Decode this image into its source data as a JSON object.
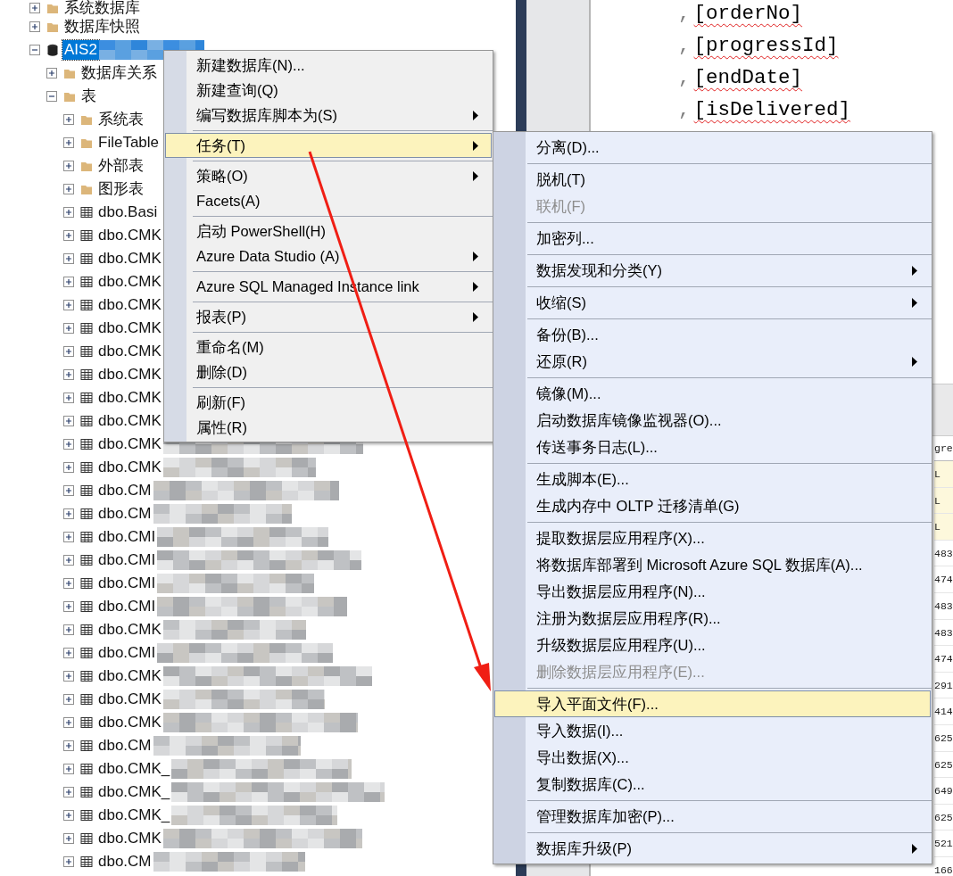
{
  "tree": [
    {
      "label": "系统数据库",
      "kind": "folder",
      "expanded": false,
      "selected": false
    },
    {
      "label": "数据库快照",
      "kind": "folder",
      "expanded": false,
      "selected": false
    },
    {
      "label": "AIS2",
      "kind": "database",
      "expanded": true,
      "selected": true,
      "redacted": true,
      "children": [
        {
          "label": "数据库关系",
          "kind": "folder",
          "expanded": false,
          "selected": false
        },
        {
          "label": "表",
          "kind": "folder",
          "expanded": true,
          "selected": false,
          "children": [
            {
              "label": "系统表",
              "kind": "folder",
              "expanded": false,
              "selected": false
            },
            {
              "label": "FileTable",
              "kind": "folder",
              "expanded": false,
              "selected": false
            },
            {
              "label": "外部表",
              "kind": "folder",
              "expanded": false,
              "selected": false
            },
            {
              "label": "图形表",
              "kind": "folder",
              "expanded": false,
              "selected": false
            },
            {
              "label": "dbo.Basi",
              "kind": "table",
              "expanded": false,
              "selected": false
            },
            {
              "label": "dbo.CMK",
              "kind": "table",
              "expanded": false,
              "selected": false
            },
            {
              "label": "dbo.CMK",
              "kind": "table",
              "expanded": false,
              "selected": false
            },
            {
              "label": "dbo.CMK",
              "kind": "table",
              "expanded": false,
              "selected": false
            },
            {
              "label": "dbo.CMK",
              "kind": "table",
              "expanded": false,
              "selected": false
            },
            {
              "label": "dbo.CMK",
              "kind": "table",
              "expanded": false,
              "selected": false
            },
            {
              "label": "dbo.CMK",
              "kind": "table",
              "expanded": false,
              "selected": false
            },
            {
              "label": "dbo.CMK",
              "kind": "table",
              "expanded": false,
              "selected": false
            },
            {
              "label": "dbo.CMK",
              "kind": "table",
              "expanded": false,
              "selected": false
            },
            {
              "label": "dbo.CMK",
              "kind": "table",
              "expanded": false,
              "selected": false
            },
            {
              "label": "dbo.CMK",
              "kind": "table",
              "expanded": false,
              "selected": false,
              "redacted": true
            },
            {
              "label": "dbo.CMK",
              "kind": "table",
              "expanded": false,
              "selected": false,
              "redacted": true
            },
            {
              "label": "dbo.CM",
              "kind": "table",
              "expanded": false,
              "selected": false,
              "redacted": true
            },
            {
              "label": "dbo.CM",
              "kind": "table",
              "expanded": false,
              "selected": false,
              "redacted": true
            },
            {
              "label": "dbo.CMI",
              "kind": "table",
              "expanded": false,
              "selected": false,
              "redacted": true
            },
            {
              "label": "dbo.CMI",
              "kind": "table",
              "expanded": false,
              "selected": false,
              "redacted": true
            },
            {
              "label": "dbo.CMI",
              "kind": "table",
              "expanded": false,
              "selected": false,
              "redacted": true
            },
            {
              "label": "dbo.CMI",
              "kind": "table",
              "expanded": false,
              "selected": false,
              "redacted": true
            },
            {
              "label": "dbo.CMK",
              "kind": "table",
              "expanded": false,
              "selected": false,
              "redacted": true
            },
            {
              "label": "dbo.CMI",
              "kind": "table",
              "expanded": false,
              "selected": false,
              "redacted": true
            },
            {
              "label": "dbo.CMK",
              "kind": "table",
              "expanded": false,
              "selected": false,
              "redacted": true
            },
            {
              "label": "dbo.CMK",
              "kind": "table",
              "expanded": false,
              "selected": false,
              "redacted": true
            },
            {
              "label": "dbo.CMK",
              "kind": "table",
              "expanded": false,
              "selected": false,
              "redacted": true
            },
            {
              "label": "dbo.CM",
              "kind": "table",
              "expanded": false,
              "selected": false,
              "redacted": true
            },
            {
              "label": "dbo.CMK_",
              "kind": "table",
              "expanded": false,
              "selected": false,
              "redacted": true
            },
            {
              "label": "dbo.CMK_",
              "kind": "table",
              "expanded": false,
              "selected": false,
              "redacted": true
            },
            {
              "label": "dbo.CMK_",
              "kind": "table",
              "expanded": false,
              "selected": false,
              "redacted": true
            },
            {
              "label": "dbo.CMK",
              "kind": "table",
              "expanded": false,
              "selected": false,
              "redacted": true
            },
            {
              "label": "dbo.CM",
              "kind": "table",
              "expanded": false,
              "selected": false,
              "redacted": true
            }
          ]
        }
      ]
    }
  ],
  "editor": {
    "lines": [
      {
        "prefix": ",",
        "identifier": "[orderNo]"
      },
      {
        "prefix": ",",
        "identifier": "[progressId]"
      },
      {
        "prefix": ",",
        "identifier": "[endDate]"
      },
      {
        "prefix": ",",
        "identifier": "[isDelivered]"
      }
    ]
  },
  "results": {
    "header": "gre",
    "rows": [
      {
        "value": "L",
        "is_null": true
      },
      {
        "value": "L",
        "is_null": true
      },
      {
        "value": "L",
        "is_null": true
      },
      {
        "value": "483",
        "is_null": false
      },
      {
        "value": "474",
        "is_null": false
      },
      {
        "value": "483",
        "is_null": false
      },
      {
        "value": "483",
        "is_null": false
      },
      {
        "value": "474",
        "is_null": false
      },
      {
        "value": "291",
        "is_null": false
      },
      {
        "value": "414",
        "is_null": false
      },
      {
        "value": "625",
        "is_null": false
      },
      {
        "value": "625",
        "is_null": false
      },
      {
        "value": "649",
        "is_null": false
      },
      {
        "value": "625",
        "is_null": false
      },
      {
        "value": "521",
        "is_null": false
      },
      {
        "value": "166",
        "is_null": false
      }
    ]
  },
  "context_menu": {
    "groups": [
      [
        {
          "label": "新建数据库(N)...",
          "has_submenu": false,
          "selected": false
        },
        {
          "label": "新建查询(Q)",
          "has_submenu": false,
          "selected": false
        },
        {
          "label": "编写数据库脚本为(S)",
          "has_submenu": true,
          "selected": false
        }
      ],
      [
        {
          "label": "任务(T)",
          "has_submenu": true,
          "selected": true
        }
      ],
      [
        {
          "label": "策略(O)",
          "has_submenu": true,
          "selected": false
        },
        {
          "label": "Facets(A)",
          "has_submenu": false,
          "selected": false
        }
      ],
      [
        {
          "label": "启动 PowerShell(H)",
          "has_submenu": false,
          "selected": false
        },
        {
          "label": "Azure Data Studio (A)",
          "has_submenu": true,
          "selected": false
        }
      ],
      [
        {
          "label": "Azure SQL Managed Instance link",
          "has_submenu": true,
          "selected": false
        }
      ],
      [
        {
          "label": "报表(P)",
          "has_submenu": true,
          "selected": false
        }
      ],
      [
        {
          "label": "重命名(M)",
          "has_submenu": false,
          "selected": false
        },
        {
          "label": "删除(D)",
          "has_submenu": false,
          "selected": false
        }
      ],
      [
        {
          "label": "刷新(F)",
          "has_submenu": false,
          "selected": false
        },
        {
          "label": "属性(R)",
          "has_submenu": false,
          "selected": false
        }
      ]
    ]
  },
  "submenu": {
    "groups": [
      [
        {
          "label": "分离(D)...",
          "has_submenu": false,
          "selected": false,
          "disabled": false
        }
      ],
      [
        {
          "label": "脱机(T)",
          "has_submenu": false,
          "selected": false,
          "disabled": false
        },
        {
          "label": "联机(F)",
          "has_submenu": false,
          "selected": false,
          "disabled": true
        }
      ],
      [
        {
          "label": "加密列...",
          "has_submenu": false,
          "selected": false,
          "disabled": false
        }
      ],
      [
        {
          "label": "数据发现和分类(Y)",
          "has_submenu": true,
          "selected": false,
          "disabled": false
        }
      ],
      [
        {
          "label": "收缩(S)",
          "has_submenu": true,
          "selected": false,
          "disabled": false
        }
      ],
      [
        {
          "label": "备份(B)...",
          "has_submenu": false,
          "selected": false,
          "disabled": false
        },
        {
          "label": "还原(R)",
          "has_submenu": true,
          "selected": false,
          "disabled": false
        }
      ],
      [
        {
          "label": "镜像(M)...",
          "has_submenu": false,
          "selected": false,
          "disabled": false
        },
        {
          "label": "启动数据库镜像监视器(O)...",
          "has_submenu": false,
          "selected": false,
          "disabled": false
        },
        {
          "label": "传送事务日志(L)...",
          "has_submenu": false,
          "selected": false,
          "disabled": false
        }
      ],
      [
        {
          "label": "生成脚本(E)...",
          "has_submenu": false,
          "selected": false,
          "disabled": false
        },
        {
          "label": "生成内存中 OLTP 迁移清单(G)",
          "has_submenu": false,
          "selected": false,
          "disabled": false
        }
      ],
      [
        {
          "label": "提取数据层应用程序(X)...",
          "has_submenu": false,
          "selected": false,
          "disabled": false
        },
        {
          "label": "将数据库部署到 Microsoft Azure SQL 数据库(A)...",
          "has_submenu": false,
          "selected": false,
          "disabled": false
        },
        {
          "label": "导出数据层应用程序(N)...",
          "has_submenu": false,
          "selected": false,
          "disabled": false
        },
        {
          "label": "注册为数据层应用程序(R)...",
          "has_submenu": false,
          "selected": false,
          "disabled": false
        },
        {
          "label": "升级数据层应用程序(U)...",
          "has_submenu": false,
          "selected": false,
          "disabled": false
        },
        {
          "label": "删除数据层应用程序(E)...",
          "has_submenu": false,
          "selected": false,
          "disabled": true
        }
      ],
      [
        {
          "label": "导入平面文件(F)...",
          "has_submenu": false,
          "selected": true,
          "disabled": false
        },
        {
          "label": "导入数据(I)...",
          "has_submenu": false,
          "selected": false,
          "disabled": false
        },
        {
          "label": "导出数据(X)...",
          "has_submenu": false,
          "selected": false,
          "disabled": false
        },
        {
          "label": "复制数据库(C)...",
          "has_submenu": false,
          "selected": false,
          "disabled": false
        }
      ],
      [
        {
          "label": "管理数据库加密(P)...",
          "has_submenu": false,
          "selected": false,
          "disabled": false
        }
      ],
      [
        {
          "label": "数据库升级(P)",
          "has_submenu": true,
          "selected": false,
          "disabled": false
        }
      ]
    ]
  }
}
